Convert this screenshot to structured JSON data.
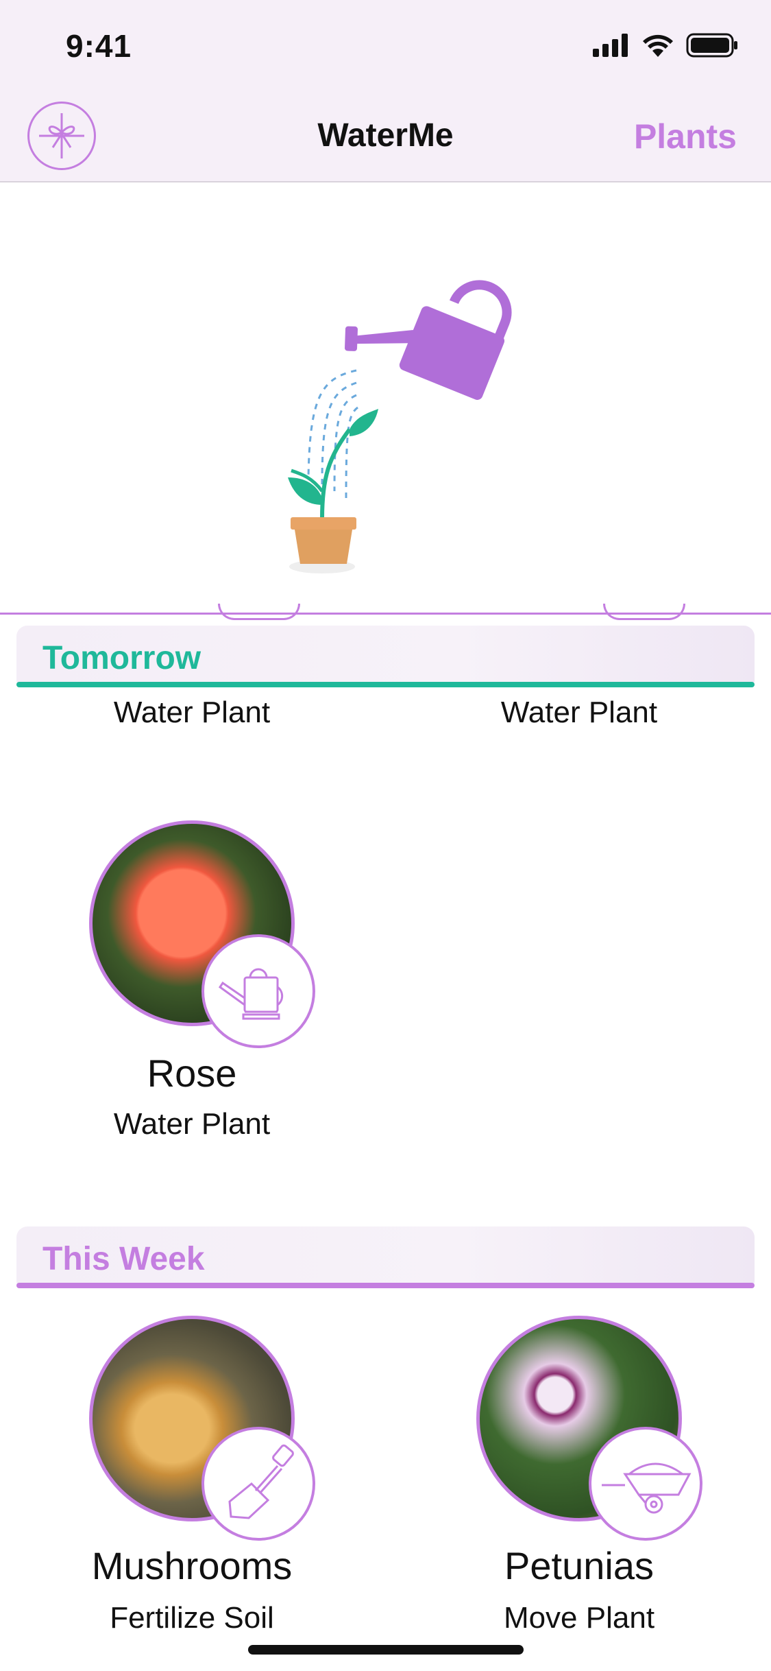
{
  "status_bar": {
    "time": "9:41"
  },
  "nav": {
    "title": "WaterMe",
    "right_button": "Plants",
    "left_icon": "gift-icon"
  },
  "colors": {
    "accent": "#c47ee0",
    "tomorrow": "#1fb89a",
    "this_week": "#c47ee0",
    "pot": "#e0a060",
    "leaf": "#22b58e",
    "can": "#b06ed8"
  },
  "sections": [
    {
      "title": "Tomorrow",
      "partial_items": [
        {
          "task": "Water Plant"
        },
        {
          "task": "Water Plant"
        }
      ],
      "items": [
        {
          "name": "Rose",
          "task": "Water Plant",
          "badge_icon": "watering-can-icon"
        }
      ]
    },
    {
      "title": "This Week",
      "items": [
        {
          "name": "Mushrooms",
          "task": "Fertilize Soil",
          "badge_icon": "shovel-icon"
        },
        {
          "name": "Petunias",
          "task": "Move Plant",
          "badge_icon": "wheelbarrow-icon"
        }
      ]
    }
  ]
}
